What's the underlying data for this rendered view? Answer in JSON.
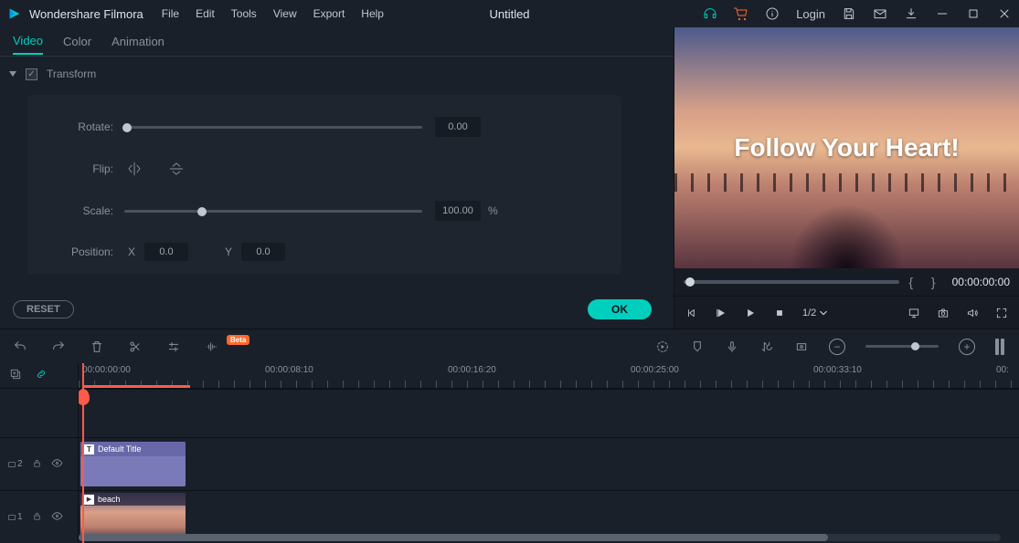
{
  "app": {
    "name": "Wondershare Filmora",
    "document": "Untitled",
    "login": "Login"
  },
  "menu": [
    "File",
    "Edit",
    "Tools",
    "View",
    "Export",
    "Help"
  ],
  "tabs": [
    "Video",
    "Color",
    "Animation"
  ],
  "activeTab": 0,
  "transform": {
    "section": "Transform",
    "labels": {
      "rotate": "Rotate:",
      "flip": "Flip:",
      "scale": "Scale:",
      "position": "Position:",
      "x": "X",
      "y": "Y",
      "pct": "%"
    },
    "rotate": "0.00",
    "scale": "100.00",
    "posX": "0.0",
    "posY": "0.0"
  },
  "buttons": {
    "reset": "RESET",
    "ok": "OK"
  },
  "preview": {
    "overlayText": "Follow Your Heart!",
    "timecode": "00:00:00:00",
    "zoom": "1/2"
  },
  "timeline": {
    "badge": "Beta",
    "ruler": [
      "00:00:00:00",
      "00:00:08:10",
      "00:00:16:20",
      "00:00:25:00",
      "00:00:33:10",
      "00:"
    ],
    "tracks": {
      "title": {
        "id": "2",
        "clipType": "T",
        "clipLabel": "Default Title"
      },
      "video": {
        "id": "1",
        "clipType": "▶",
        "clipLabel": "beach"
      }
    }
  }
}
